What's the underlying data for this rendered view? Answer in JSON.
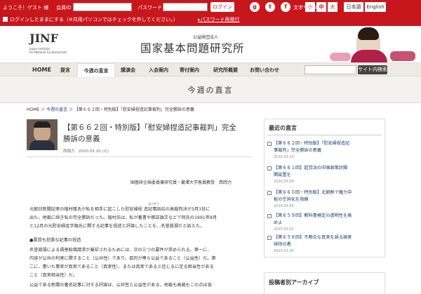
{
  "topbar": {
    "greeting": "ようこそ！ゲスト 様",
    "member_id_label": "会員ID",
    "password_label": "パスワード",
    "login_button": "ログイン",
    "keep_login": "ログインしたままにする（※共用パソコンではチェックを外してください。）",
    "password_reset": "パスワード再発行",
    "text_size_label": "文字サイズ",
    "size_small": "小",
    "size_medium": "中",
    "size_large": "大",
    "lang_ja": "日本語",
    "lang_en": "English",
    "colors": {
      "brand": "#c8161d"
    }
  },
  "header": {
    "logo": "JINF",
    "logo_sub1": "Japan Institute",
    "logo_sub2": "for National Fundamentals",
    "org_type": "公益財団法人",
    "org_name": "国家基本問題研究所",
    "search_button": "サイト内検索"
  },
  "nav": [
    {
      "label": "HOME"
    },
    {
      "label": "提言"
    },
    {
      "label": "今週の直言"
    },
    {
      "label": "講演会"
    },
    {
      "label": "入会案内"
    },
    {
      "label": "寄付案内"
    },
    {
      "label": "研究所概要"
    },
    {
      "label": "お問い合わせ"
    }
  ],
  "page_title": "今週の直言",
  "breadcrumb": {
    "home": "HOME",
    "section": "今週の直言",
    "current": "【第６６２回・特別版】「慰安婦捏造記事裁判」完全勝訴の意義"
  },
  "article": {
    "title_line1": "【第６６２回・特別版】「慰安婦捏造記事裁判」完全",
    "title_line2": "勝訴の意義",
    "author": "西岡力",
    "date": "2020.03.10 (火)",
    "affiliation": "国基研企画委員兼研究員・麗澤大学客員教授　西岡力",
    "ruby": "ねつぞう",
    "p1": [
      "元朝日新聞記者の植村隆氏が私を相手に起こした慰安婦捏 造記事訴訟の高裁判決が3月3日に",
      "出た。地裁に続き私の完全勝訴だった。植村氏は、私が著書や雑誌論文などで同氏の1991年8月",
      "と12月の元慰安婦金学順氏に関する記事を捏造と評論したことを、名誉毀損だと訴えた。"
    ],
    "heading": "●悪質も犯罪な記事の捏造",
    "p2": [
      "名誉毀損による損害賠償請求が棄却されるためには、次の三つの要件が求められる。第一に、",
      "内容が公共の利害に関すること（公共性）であり、目的が専ら公益であること（公益性）だ。第",
      "二に、書いた事実が真実であること（真実性）、または真実であると信じるに足る相当性がある",
      "こと（真実相当性）だ。",
      "公益である新聞の著名記事に対する評論は、公共性と公益性がある。地裁も高裁もこの点は容"
    ]
  },
  "sidebar": {
    "title": "最近の直言",
    "items": [
      {
        "l1": "【第６６２回・特別版】「慰安婦捏造記",
        "l2": "事裁判」完全勝訴の意義",
        "date": "2020.03.10"
      },
      {
        "l1": "【第６６１回】超党派の中国政策討閣",
        "l2": "関設置を",
        "date": "2020.03.09"
      },
      {
        "l1": "【第６６０回・特別版】北朝鮮で権力中",
        "l2": "枢の空洞化を指摘",
        "date": "2020.03.05"
      },
      {
        "l1": "【第６５９回】教科書検定の透明性を高",
        "l2": "めよ",
        "date": "2020.03.02"
      },
      {
        "l1": "【第６５８回】不都合な真実を語る論者",
        "l2": "排除の愚",
        "date": "2020.02.25"
      }
    ],
    "archive_title": "投稿者別アーカイブ"
  }
}
